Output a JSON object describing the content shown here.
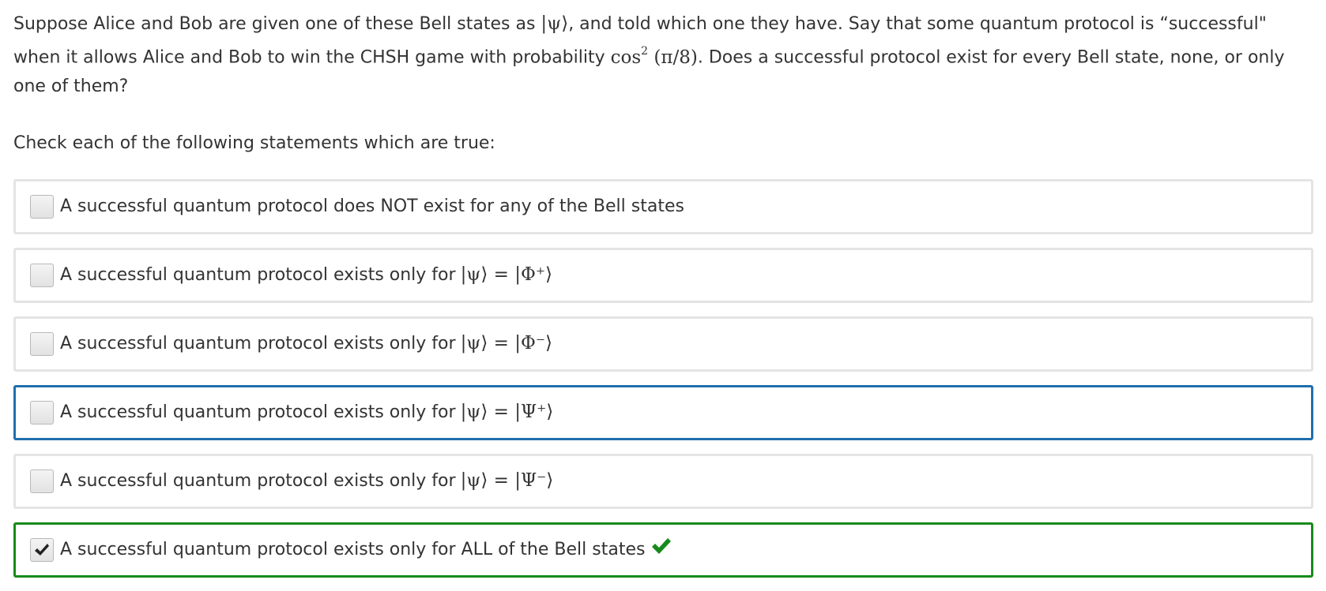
{
  "question": {
    "part1": "Suppose Alice and Bob are given one of these Bell states as ",
    "psi_ket": "|ψ⟩",
    "part2": ", and told which one they have. Say that some quantum protocol is “successful\" when it allows Alice and Bob to win the CHSH game with probability ",
    "prob_cos": "cos",
    "prob_exp": "2",
    "prob_arg": " (π/8)",
    "part3": ". Does a successful protocol exist for every Bell state, none, or only one of them?"
  },
  "prompt": "Check each of the following statements which are true:",
  "choices": [
    {
      "text": "A successful quantum protocol does NOT exist for any of the Bell states",
      "math": "",
      "checked": false,
      "state": "default"
    },
    {
      "text": "A successful quantum protocol exists only for",
      "math": "|ψ⟩ = |Φ⁺⟩",
      "checked": false,
      "state": "default"
    },
    {
      "text": "A successful quantum protocol exists only for",
      "math": "|ψ⟩ = |Φ⁻⟩",
      "checked": false,
      "state": "default"
    },
    {
      "text": "A successful quantum protocol exists only for",
      "math": "|ψ⟩ = |Ψ⁺⟩",
      "checked": false,
      "state": "focused"
    },
    {
      "text": "A successful quantum protocol exists only for",
      "math": "|ψ⟩ = |Ψ⁻⟩",
      "checked": false,
      "state": "default"
    },
    {
      "text": "A successful quantum protocol exists only for ALL of the Bell states",
      "math": "",
      "checked": true,
      "state": "correct"
    }
  ],
  "icons": {
    "checkbox_check": "checkmark-icon",
    "correct_indicator": "correct-checkmark-icon"
  },
  "colors": {
    "text": "#333333",
    "border_default": "#e4e4e4",
    "border_focused": "#1f6fad",
    "border_correct": "#178a1b",
    "correct_icon": "#178a1b",
    "checkbox_check": "#222222"
  }
}
